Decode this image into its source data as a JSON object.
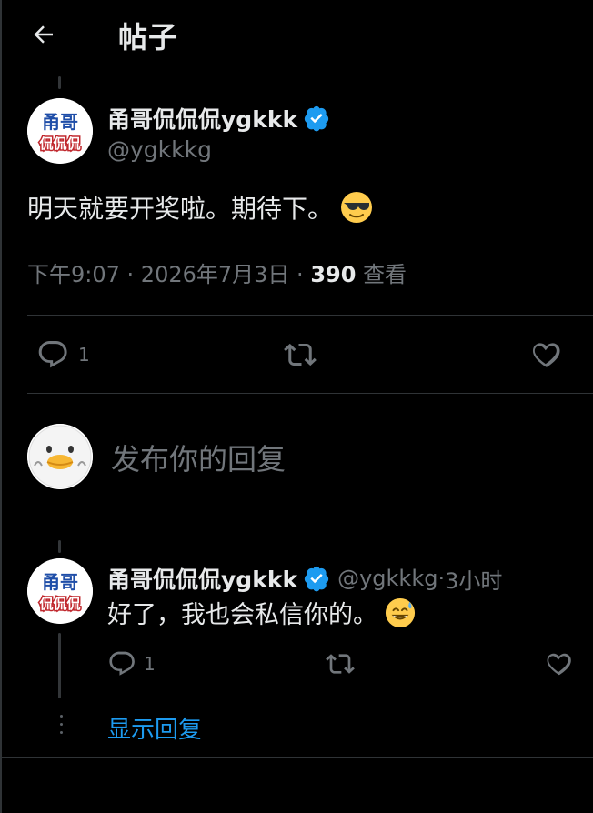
{
  "header": {
    "back_icon": "arrow-left-icon",
    "title": "帖子"
  },
  "post": {
    "author_name": "甬哥侃侃侃ygkkk",
    "author_handle": "@ygkkkg",
    "avatar_text_top": "甬哥",
    "avatar_text_bottom": "侃侃侃",
    "text": "明天就要开奖啦。期待下。",
    "emoji": "smiling-face-with-sunglasses-icon",
    "time": "下午9:07",
    "date": "2026年7月3日",
    "views_count": "390",
    "views_label": "查看",
    "sep1": " · ",
    "sep2": " · ",
    "actions": {
      "reply_count": "1",
      "reply_icon": "comment-icon",
      "repost_icon": "repost-icon",
      "like_icon": "heart-icon"
    }
  },
  "composer": {
    "placeholder": "发布你的回复",
    "avatar_icon": "duck-avatar-icon"
  },
  "reply": {
    "author_name": "甬哥侃侃侃ygkkk",
    "author_handle": "@ygkkkg",
    "sep": " · ",
    "time_ago": "3小时",
    "text": "好了，我也会私信你的。",
    "emoji": "grinning-face-with-sweat-icon",
    "reply_count": "1",
    "show_replies": "显示回复"
  },
  "colors": {
    "background": "#000000",
    "text": "#e7e9ea",
    "muted": "#71767b",
    "accent": "#1d9bf0",
    "divider": "#2f3336"
  }
}
